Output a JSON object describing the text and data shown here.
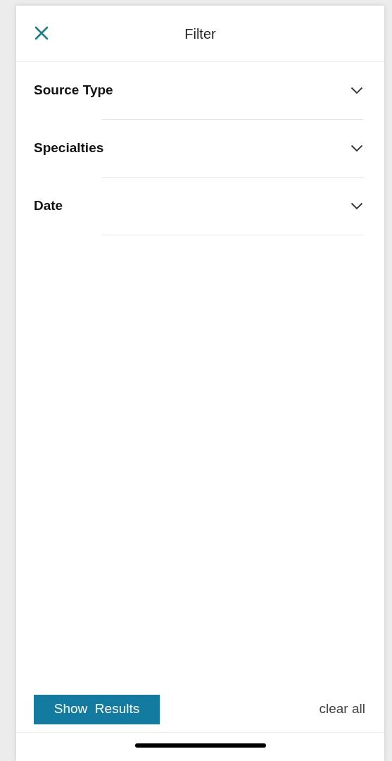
{
  "header": {
    "title": "Filter"
  },
  "sections": [
    {
      "label": "Source Type",
      "expanded": false
    },
    {
      "label": "Specialties",
      "expanded": false
    },
    {
      "label": "Date",
      "expanded": false
    }
  ],
  "footer": {
    "primary_button": "Show  Results",
    "secondary_link": "clear all"
  }
}
